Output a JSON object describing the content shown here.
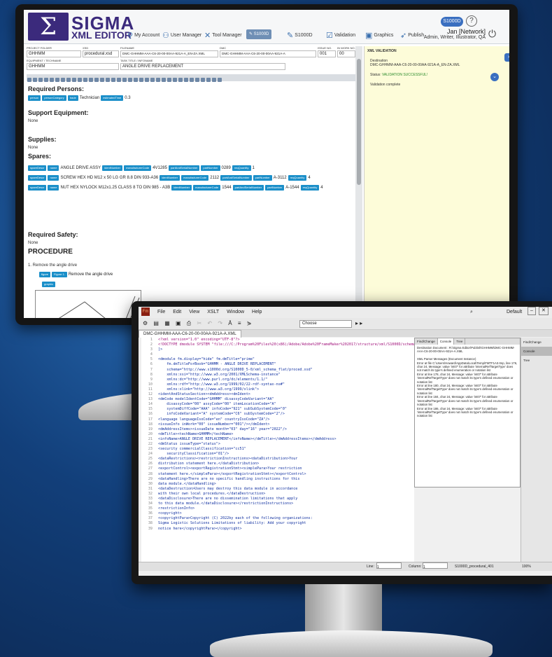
{
  "back_app": {
    "logo_mark": "Σ",
    "logo_title": "SIGMA",
    "logo_subtitle": "XML EDITOR",
    "nav": {
      "my_account": "My Account",
      "user_manager": "User Manager",
      "tool_manager": "Tool Manager",
      "s1000d_1": "S1000D",
      "s1000d_2": "S1000D",
      "validation": "Validation",
      "graphics": "Graphics",
      "publish": "Publish"
    },
    "top_pill": "S1000D",
    "help": "?",
    "user_name": "Jan [Network]",
    "user_roles": "Admin, Writer, Illustrator, QA",
    "power_icon": "⏻",
    "meta": {
      "project_folder_label": "PROJECT FOLDER",
      "project_folder": "GHHMM",
      "xsd_label": "XSD",
      "xsd": "procedural.xsd",
      "filename_label": "FILENAME",
      "filename": "DMC-GHHMM-AAA-C6-20-00-00AA-921A-A_EN-ZA.XML",
      "dmc_label": "DMC",
      "dmc": "DMC-GHHMM-AAA-C6-20-00-00AA-921A-A",
      "issue_label": "ISSUE NO.",
      "issue": "001",
      "inwork_label": "IN WORK NO.",
      "inwork": "00",
      "equipment_label": "EQUIPMENT / TECHNAME",
      "equipment": "GHHMM",
      "title_label": "TASK TITLE / INFONAME",
      "title": "ANGLE DRIVE REPLACEMENT"
    },
    "doc": {
      "required_persons": "Required Persons:",
      "persons_tags": [
        "person",
        "personCategory",
        "trade"
      ],
      "technician": "Technician",
      "estimated_time_tag": "estimatedTime",
      "estimated_time": "0.3",
      "support_equipment": "Support Equipment:",
      "none1": "None",
      "supplies": "Supplies:",
      "none2": "None",
      "spares": "Spares:",
      "spare_rows": [
        {
          "tags": [
            "spareDescr",
            "name"
          ],
          "text": "ANGLE DRIVE ASSY",
          "after": [
            "identNumber",
            "manufacturerCode"
          ],
          "code": "4V1285",
          "tail": [
            "partAndSerialNumber",
            "partNumber"
          ],
          "pn": "0289",
          "qty_tag": "reqQuantity",
          "qty": "1"
        },
        {
          "tags": [
            "spareDescr",
            "name"
          ],
          "text": "SCREW HEX HD M12 x 50 LG GR 8.8 DIN 933-A36",
          "after": [
            "identNumber",
            "manufacturerCode"
          ],
          "code": "2112",
          "tail": [
            "partAndSerialNumber",
            "partNumber"
          ],
          "pn": "A-3112",
          "qty_tag": "reqQuantity",
          "qty": "4"
        },
        {
          "tags": [
            "spareDescr",
            "name"
          ],
          "text": "NUT HEX NYLOCK M12x1.25 CLASS 8 TO DIN 985 - A3B",
          "after": [
            "identNumber",
            "manufacturerCode"
          ],
          "code": "1544",
          "tail": [
            "partAndSerialNumber",
            "partNumber"
          ],
          "pn": "A-1544",
          "qty_tag": "reqQuantity",
          "qty": "4"
        }
      ],
      "required_safety": "Required Safety:",
      "none3": "None",
      "procedure": "PROCEDURE",
      "step1": "1. Remove the angle drive",
      "figure_tags": [
        "figure",
        "Figure 1."
      ],
      "figure_title": "Remove the angle drive",
      "graphic_tag": "graphic"
    },
    "side": {
      "header": "XML VALIDATION",
      "dest_label": "Destination",
      "dest": "DMC-GHHMM-AAA-C6-20-00-00AA-921A-A_EN-ZA.XML",
      "status_label": "Status",
      "status_value": "VALIDATION SUCCESSFUL!",
      "complete": "Validation complete"
    }
  },
  "front_app": {
    "menu": [
      "File",
      "Edit",
      "View",
      "XSLT",
      "Window",
      "Help"
    ],
    "logo": "Fm",
    "choose": "Choose",
    "workspace": "Default",
    "tab": "DMC-GHHMM-AAA-C6-20-00-00AA-921A-A.XML",
    "code_lines": [
      "<?xml version=\"1.0\" encoding=\"UTF-8\"?>",
      "<!DOCTYPE dmodule SYSTEM \"file:///C:/Program%20Files%20(x86)/Adobe/Adobe%20FrameMaker%202017/structure/xml/S1000D/schema402/pro",
      "]>",
      "",
      "<dmodule fm.display=\"hide\" fm.dmTitle=\"prime\"",
      "    fm.dmTitleForBook=\"GHHMM - ANGLE DRIVE REPLACEMENT\"",
      "    schema=\"http://www.s1000d.org/S1000D_5-0/xml_schema_flat/proced.xsd\"",
      "    xmlns:xsi=\"http://www.w3.org/2001/XMLSchema-instance\"",
      "    xmlns:dc=\"http://www.purl.org/dc/elements/1.1/\"",
      "    xmlns:rdf=\"http://www.w3.org/1999/02/22-rdf-syntax-ns#\"",
      "    xmlns:xlink=\"http://www.w3.org/1999/xlink\">",
      "<identAndStatusSection><dmAddress><dmIdent>",
      "<dmCode modelIdentCode=\"GHHMM\" disassyCodeVariant=\"AA\"",
      "    disassyCode=\"00\" assyCode=\"00\" itemLocationCode=\"A\"",
      "    systemDiffCode=\"AAA\" infoCode=\"921\" subSubSystemCode=\"0\"",
      "    infoCodeVariant=\"A\" systemCode=\"C6\" subSystemCode=\"2\"/>",
      "<language languageIsoCode=\"en\" countryIsoCode=\"ZA\"/>",
      "<issueInfo inWork=\"00\" issueNumber=\"001\"/></dmIdent>",
      "<dmAddressItems><issueDate month=\"03\" day=\"16\" year=\"2022\"/>",
      "<dmTitle><techName>GHHMM</techName>",
      "<infoName>ANGLE DRIVE REPLACEMENT</infoName></dmTitle></dmAddressItems></dmAddress>",
      "<dmStatus issueType=\"status\">",
      "<security commercialClassification=\"cc51\"",
      "    securityClassification=\"01\"/>",
      "<dataRestrictions><restrictionInstructions><dataDistribution>Your",
      "distribution statement here.</dataDistribution>",
      "<exportControl><exportRegistrationStmt><simplePara>Your restriction",
      "statement here.</simplePara></exportRegistrationStmt></exportControl>",
      "<dataHandling>There are no specific handling instructions for this",
      "data module.</dataHandling>",
      "<dataDestruction>Users may destroy this data module in accordance",
      "with their own local procedures.</dataDestruction>",
      "<dataDisclosure>There are no dissemination limitations that apply",
      "to this data module.</dataDisclosure></restrictionInstructions>",
      "<restrictionInfo>",
      "<copyright>",
      "<copyrightPara>Copyright (C) 2022by each of the following organizations:",
      "Sigma Logistic Solutions Limitations of liability: Add your copyright",
      "notice here</copyrightPara></copyright>"
    ],
    "panel_tabs": [
      "Find/Change",
      "Console",
      "Tree"
    ],
    "panel_text": [
      "Destination Document : R:\\Sigma Editor\\Publish\\GHHMM\\DMC-GHHMM-AAA-C6-20-00-00AA-921A-A.XML",
      "",
      "XML Parser Messages (Document Instance)",
      "Error at file C:\\Users\\Howard\\AppData\\Local\\Temp\\FMTF1A3.tmp, line 176, char 24, Message: value 'int07' for attribute 'internalRefTargetType' does not match its type's defined enumeration or notation list",
      "Error at line 178, char 24, Message: value 'int07' for attribute 'internalRefTargetType' does not match its type's defined enumeration or notation list",
      "Error at line 180, char 24, Message: value 'int07' for attribute 'internalRefTargetType' does not match its type's defined enumeration or notation list",
      "Error at line 184, char 24, Message: value 'int07' for attribute 'internalRefTargetType' does not match its type's defined enumeration or notation list",
      "Error at line 186, char 24, Message: value 'int07' for attribute 'internalRefTargetType' does not match its type's defined enumeration or notation list"
    ],
    "right_panel": [
      "Find/Change",
      "Console",
      "Tree"
    ],
    "status": {
      "line_label": "Line:",
      "line": "1",
      "column_label": "Column:",
      "column": "1",
      "doc": "S1000D_procedural_401",
      "zoom": "100%"
    }
  }
}
